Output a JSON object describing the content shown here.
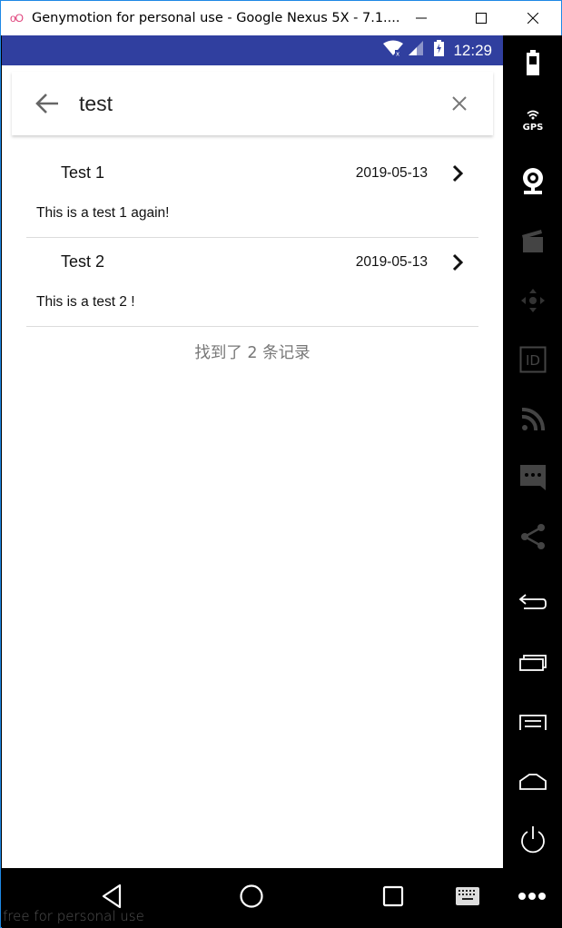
{
  "window": {
    "title": "Genymotion for personal use - Google Nexus 5X - 7.1....",
    "logo_text": "oO",
    "buttons": [
      "minimize",
      "maximize",
      "close"
    ]
  },
  "statusbar": {
    "time": "12:29",
    "icons": [
      "wifi-off-icon",
      "signal-icon",
      "battery-charging-icon"
    ],
    "color": "#303f9f"
  },
  "search": {
    "query": "test",
    "back_icon": "arrow-left-icon",
    "clear_icon": "close-icon"
  },
  "results": [
    {
      "title": "Test 1",
      "date": "2019-05-13",
      "content": "This is a test 1 again!"
    },
    {
      "title": "Test 2",
      "date": "2019-05-13",
      "content": "This is a test 2 !"
    }
  ],
  "result_count_text": "找到了 2 条记录",
  "navbar": {
    "buttons": [
      "back",
      "home",
      "recents",
      "keyboard",
      "more"
    ]
  },
  "sidebar": {
    "buttons": [
      "battery",
      "gps",
      "webcam",
      "capture",
      "dpad",
      "identifiers",
      "broadcast",
      "sms",
      "share",
      "back",
      "recents",
      "menu",
      "home",
      "power",
      "more"
    ],
    "gps_label": "GPS",
    "id_label": "ID"
  },
  "watermark": "free for personal use"
}
